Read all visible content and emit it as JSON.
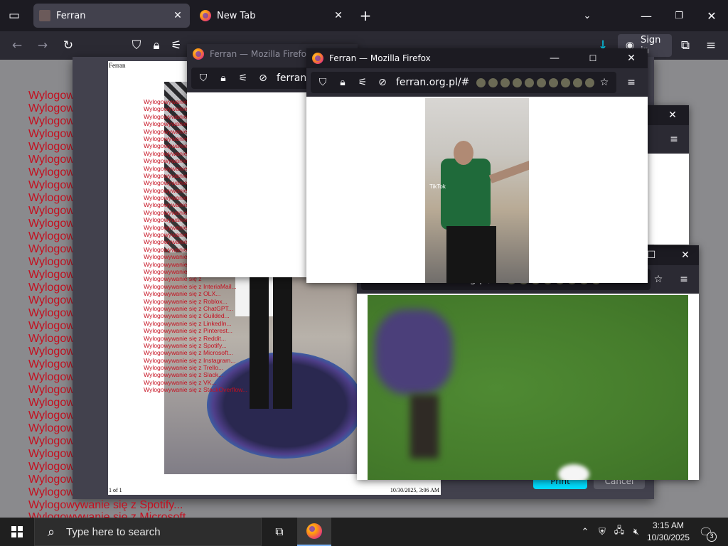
{
  "browser": {
    "tabs": [
      {
        "title": "Ferran"
      },
      {
        "title": "New Tab"
      }
    ],
    "signin_label": "Sign in"
  },
  "background_lines": {
    "truncated": "Wylogow",
    "full_1": "Wylogowywanie się z Spotify...",
    "full_2": "Wylogowywanie się z Microsoft..."
  },
  "print_preview": {
    "header": "Ferran",
    "page_label": "1 of 1",
    "date": "10/30/2025, 3:06 AM",
    "truncated_line": "Wylogowywanie się z",
    "lines": [
      "Wylogowywanie się z InteriaMail...",
      "Wylogowywanie się z OLX...",
      "Wylogowywanie się z Roblox...",
      "Wylogowywanie się z ChatGPT...",
      "Wylogowywanie się z Guilded...",
      "Wylogowywanie się z LinkedIn...",
      "Wylogowywanie się z Pinterest...",
      "Wylogowywanie się z Reddit...",
      "Wylogowywanie się z Spotify...",
      "Wylogowywanie się z Microsoft...",
      "Wylogowywanie się z Instagram...",
      "Wylogowywanie się z Trello...",
      "Wylogowywanie się z Slack...",
      "Wylogowywanie się z VK...",
      "Wylogowywanie się z StackOverflow..."
    ],
    "print_button": "Print",
    "cancel_button": "Cancel"
  },
  "popup_back": {
    "title": "Ferran — Mozilla Firefox",
    "url": "ferran.org.pl"
  },
  "popup_front": {
    "title": "Ferran — Mozilla Firefox",
    "url": "ferran.org.pl/#",
    "video_watermark": "TikTok"
  },
  "popup_bottom": {
    "url": "ferran.org.pl/#"
  },
  "taskbar": {
    "search_placeholder": "Type here to search",
    "time": "3:15 AM",
    "date": "10/30/2025",
    "notification_count": "3"
  }
}
